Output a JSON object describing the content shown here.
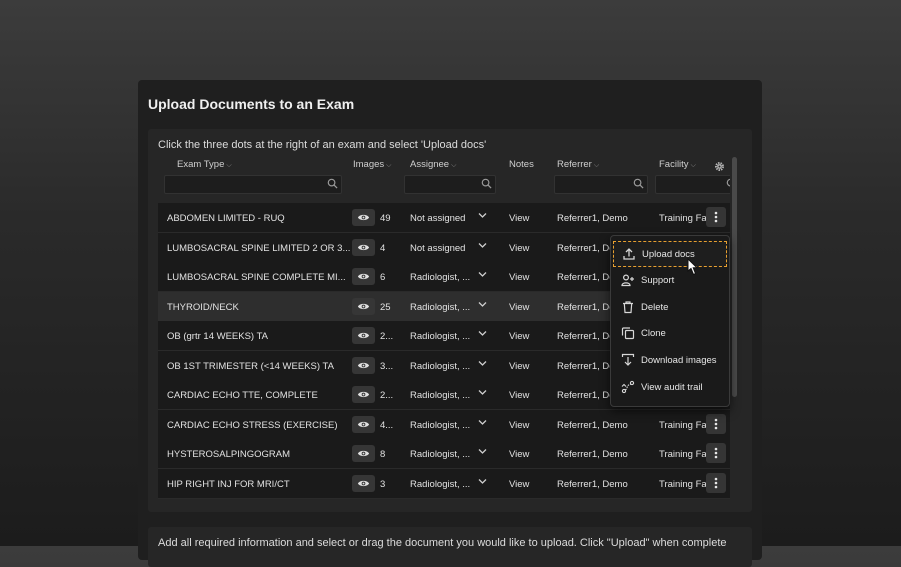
{
  "panel": {
    "title": "Upload Documents to an Exam",
    "instruction": "Click the three dots at the right of an exam and select 'Upload docs'",
    "bottom_instruction": "Add all required information and select or drag the document you would like to upload. Click \"Upload\" when complete"
  },
  "table": {
    "columns": [
      "Exam Type",
      "Images",
      "Assignee",
      "Notes",
      "Referrer",
      "Facility"
    ],
    "rows": [
      {
        "exam_type": "ABDOMEN LIMITED - RUQ",
        "images": "49",
        "assignee": "Not assigned",
        "notes": "View",
        "referrer": "Referrer1, Demo",
        "facility": "Training Fa"
      },
      {
        "exam_type": "LUMBOSACRAL SPINE LIMITED 2 OR 3...",
        "images": "4",
        "assignee": "Not assigned",
        "notes": "View",
        "referrer": "Referrer1, De",
        "facility": ""
      },
      {
        "exam_type": "LUMBOSACRAL SPINE COMPLETE MI...",
        "images": "6",
        "assignee": "Radiologist, ...",
        "notes": "View",
        "referrer": "Referrer1, De",
        "facility": ""
      },
      {
        "exam_type": "THYROID/NECK",
        "images": "25",
        "assignee": "Radiologist, ...",
        "notes": "View",
        "referrer": "Referrer1, De",
        "facility": ""
      },
      {
        "exam_type": "OB (grtr 14 WEEKS) TA",
        "images": "2...",
        "assignee": "Radiologist, ...",
        "notes": "View",
        "referrer": "Referrer1, De",
        "facility": ""
      },
      {
        "exam_type": "OB 1ST TRIMESTER (<14 WEEKS) TA",
        "images": "3...",
        "assignee": "Radiologist, ...",
        "notes": "View",
        "referrer": "Referrer1, De",
        "facility": ""
      },
      {
        "exam_type": "CARDIAC ECHO TTE, COMPLETE",
        "images": "2...",
        "assignee": "Radiologist, ...",
        "notes": "View",
        "referrer": "Referrer1, De",
        "facility": ""
      },
      {
        "exam_type": "CARDIAC ECHO STRESS (EXERCISE)",
        "images": "4...",
        "assignee": "Radiologist, ...",
        "notes": "View",
        "referrer": "Referrer1, Demo",
        "facility": "Training Fa"
      },
      {
        "exam_type": "HYSTEROSALPINGOGRAM",
        "images": "8",
        "assignee": "Radiologist, ...",
        "notes": "View",
        "referrer": "Referrer1, Demo",
        "facility": "Training Fa"
      },
      {
        "exam_type": "HIP RIGHT INJ FOR MRI/CT",
        "images": "3",
        "assignee": "Radiologist, ...",
        "notes": "View",
        "referrer": "Referrer1, Demo",
        "facility": "Training Fa"
      }
    ]
  },
  "context_menu": {
    "items": [
      {
        "label": "Upload docs",
        "icon": "upload-icon"
      },
      {
        "label": "Support",
        "icon": "person-add-icon"
      },
      {
        "label": "Delete",
        "icon": "trash-icon"
      },
      {
        "label": "Clone",
        "icon": "copy-icon"
      },
      {
        "label": "Download images",
        "icon": "download-icon"
      },
      {
        "label": "View audit trail",
        "icon": "audit-trail-icon"
      }
    ]
  },
  "colors": {
    "highlight_border": "#e8a030",
    "row_dark": "#1a1a1a",
    "row_light": "#2e2e2e"
  }
}
